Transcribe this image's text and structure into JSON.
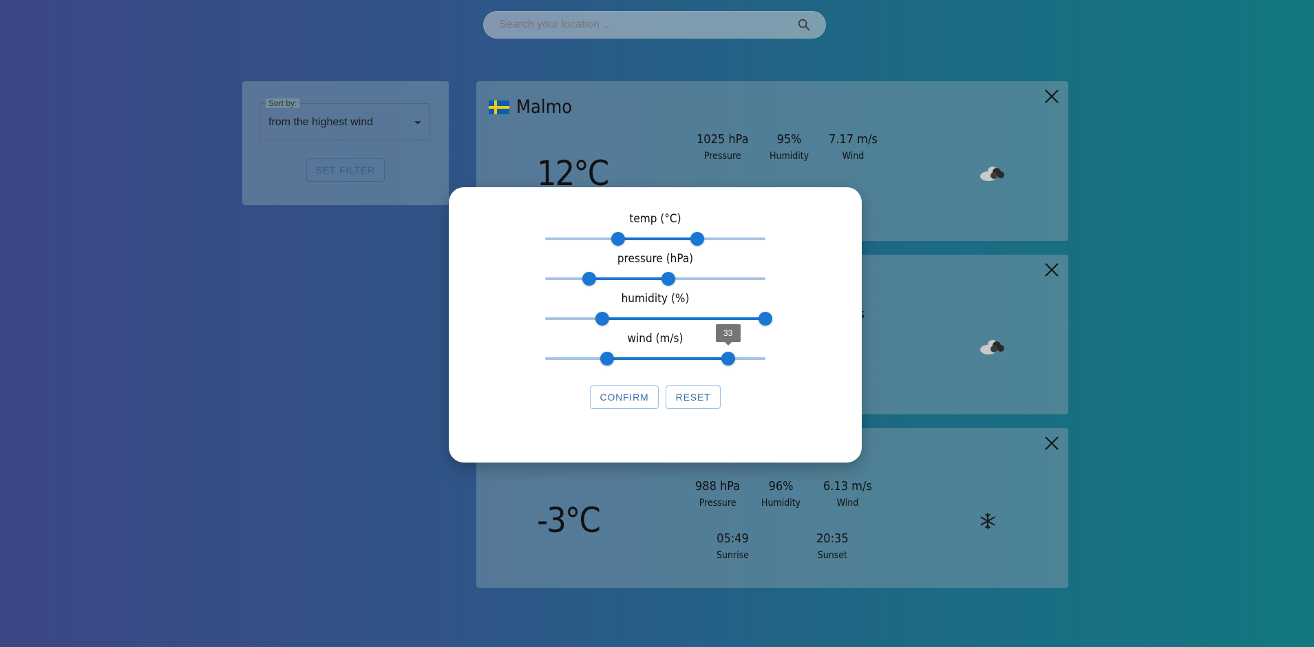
{
  "search": {
    "placeholder": "Search your location ..."
  },
  "filter": {
    "sort_label": "Sort by:",
    "sort_value": "from the highest wind",
    "set_filter_label": "SET FILTER"
  },
  "cards": [
    {
      "city": "Malmo",
      "temp": "12°C",
      "pressure": "1025 hPa",
      "pressure_label": "Pressure",
      "humidity": "95%",
      "humidity_label": "Humidity",
      "wind": "7.17 m/s",
      "wind_label": "Wind",
      "icon": "cloud-icon"
    },
    {
      "wind_partial": "/s",
      "icon": "cloud-icon"
    },
    {
      "temp": "-3°C",
      "pressure": "988 hPa",
      "pressure_label": "Pressure",
      "humidity": "96%",
      "humidity_label": "Humidity",
      "wind": "6.13 m/s",
      "wind_label": "Wind",
      "sunrise": "05:49",
      "sunrise_label": "Sunrise",
      "sunset": "20:35",
      "sunset_label": "Sunset",
      "icon": "snowflake-icon"
    }
  ],
  "modal": {
    "sliders": [
      {
        "label": "temp (°C)",
        "low": 0.33,
        "high": 0.69
      },
      {
        "label": "pressure (hPa)",
        "low": 0.2,
        "high": 0.56
      },
      {
        "label": "humidity (%)",
        "low": 0.26,
        "high": 1.0
      },
      {
        "label": "wind (m/s)",
        "low": 0.28,
        "high": 0.83,
        "tooltip": "33"
      }
    ],
    "confirm_label": "CONFIRM",
    "reset_label": "RESET"
  },
  "colors": {
    "accent": "#1976d2",
    "rail": "#a7c4e6"
  }
}
